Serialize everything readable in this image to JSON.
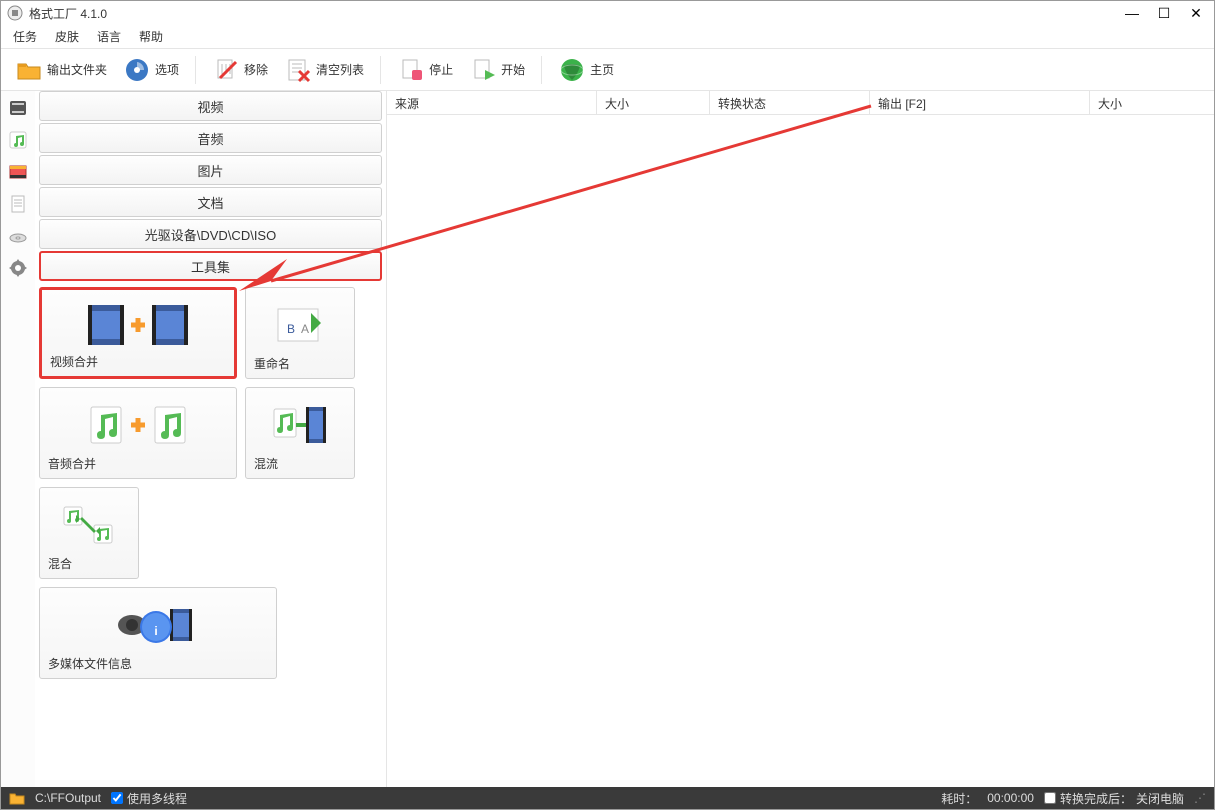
{
  "title": "格式工厂 4.1.0",
  "menu": {
    "tasks": "任务",
    "skin": "皮肤",
    "language": "语言",
    "help": "帮助"
  },
  "toolbar": {
    "output_folder": "输出文件夹",
    "options": "选项",
    "remove": "移除",
    "clear_list": "清空列表",
    "stop": "停止",
    "start": "开始",
    "homepage": "主页"
  },
  "categories": {
    "video": "视频",
    "audio": "音频",
    "picture": "图片",
    "document": "文档",
    "rom": "光驱设备\\DVD\\CD\\ISO",
    "toolset": "工具集"
  },
  "tools": {
    "video_merge": "视频合并",
    "rename": "重命名",
    "audio_merge": "音频合并",
    "mux": "混流",
    "mix": "混合",
    "media_info": "多媒体文件信息"
  },
  "columns": {
    "source": "来源",
    "size": "大小",
    "state": "转换状态",
    "output": "输出 [F2]",
    "size2": "大小"
  },
  "status": {
    "output_path": "C:\\FFOutput",
    "multithread": "使用多线程",
    "elapsed_label": "耗时：",
    "elapsed_value": "00:00:00",
    "after_label": "转换完成后：",
    "after_value": "关闭电脑"
  }
}
